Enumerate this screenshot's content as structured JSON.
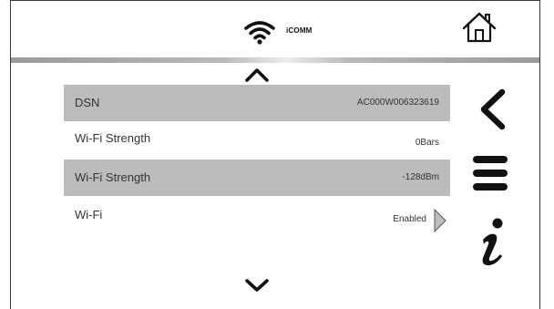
{
  "header": {
    "brand_text": "iCOMM",
    "wifi_icon": "wifi-icon",
    "home_icon": "home-icon"
  },
  "colors": {
    "row_shaded": "#bcbcbc",
    "text": "#333333",
    "frame": "#3a3a3a",
    "icon": "#111111",
    "divider": "#a8a8a8"
  },
  "list": {
    "rows": [
      {
        "label": "DSN",
        "value": "AC000W006323619"
      },
      {
        "label": "Wi-Fi Strength",
        "value": "0Bars"
      },
      {
        "label": "Wi-Fi Strength",
        "value": "-128dBm"
      },
      {
        "label": "Wi-Fi",
        "value": "Enabled"
      }
    ]
  },
  "nav": {
    "up_icon": "chevron-up-icon",
    "down_icon": "chevron-down-icon",
    "back_icon": "back-arrow-icon",
    "menu_icon": "menu-icon",
    "info_icon": "info-icon"
  }
}
